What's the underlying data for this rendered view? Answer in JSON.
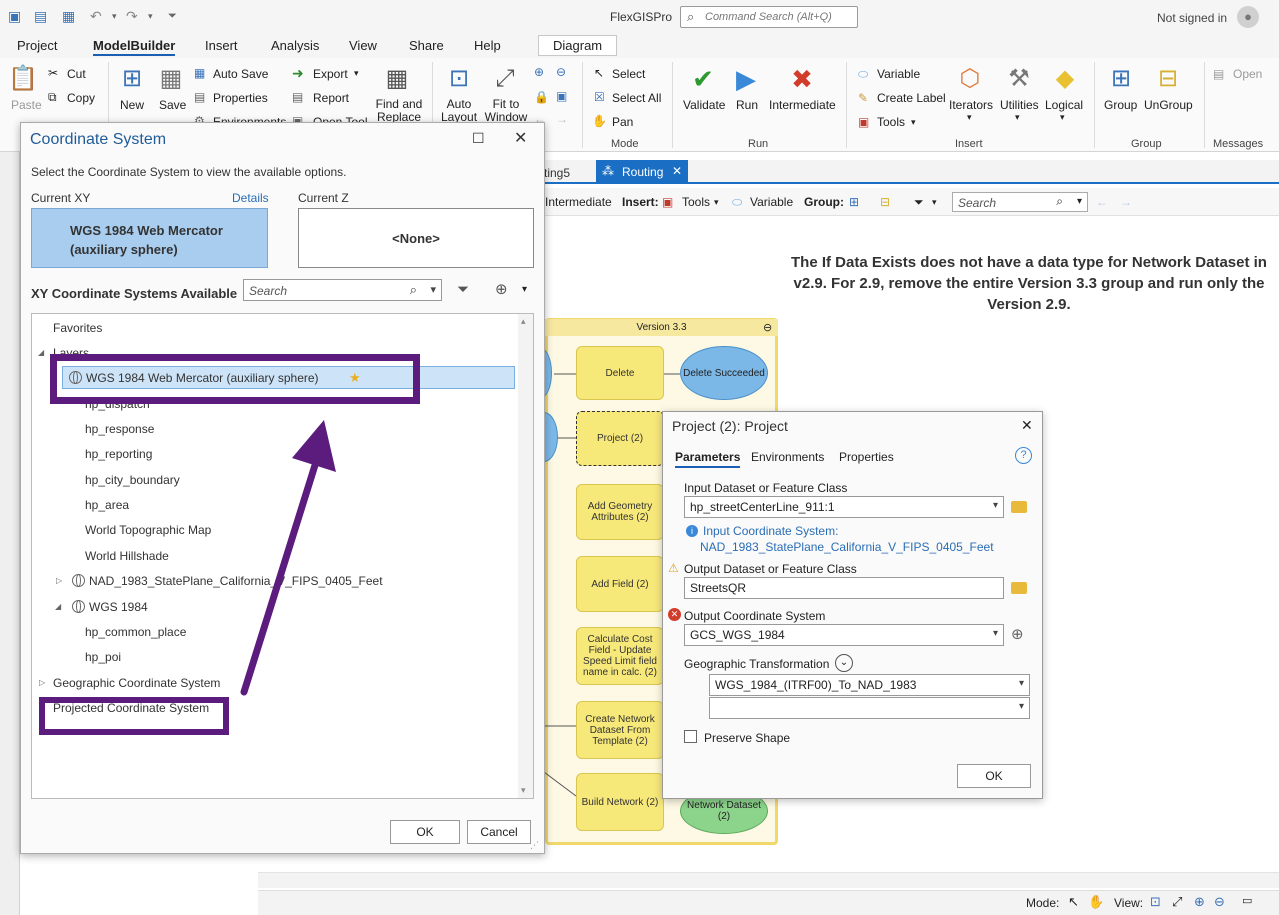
{
  "app": {
    "title": "FlexGISPro",
    "command_search_placeholder": "Command Search (Alt+Q)",
    "signin": "Not signed in"
  },
  "ribbon_tabs": [
    "Project",
    "ModelBuilder",
    "Insert",
    "Analysis",
    "View",
    "Share",
    "Help",
    "Diagram"
  ],
  "ribbon": {
    "paste": "Paste",
    "cut": "Cut",
    "copy": "Copy",
    "new": "New",
    "save": "Save",
    "auto_save": "Auto Save",
    "properties": "Properties",
    "environments": "Environments",
    "export": "Export",
    "report": "Report",
    "open_tool": "Open Tool",
    "find_replace": "Find and Replace",
    "auto_layout": "Auto Layout",
    "fit_to_window": "Fit to Window",
    "select": "Select",
    "select_all": "Select All",
    "pan": "Pan",
    "mode_group": "Mode",
    "validate": "Validate",
    "run": "Run",
    "intermediate": "Intermediate",
    "run_group": "Run",
    "variable": "Variable",
    "create_label": "Create Label",
    "tools": "Tools",
    "iterators": "Iterators",
    "utilities": "Utilities",
    "logical": "Logical",
    "insert_group": "Insert",
    "group": "Group",
    "ungroup": "UnGroup",
    "group_group": "Group",
    "open": "Open",
    "messages_group": "Messages"
  },
  "model_view": {
    "prev_tab": "ting5",
    "tab": "Routing",
    "toolbar": {
      "intermediate": "Intermediate",
      "insert": "Insert:",
      "tools": "Tools",
      "variable": "Variable",
      "group": "Group:",
      "search_placeholder": "Search"
    },
    "note": "The If Data Exists does not have a data type for Network Dataset in v2.9.  For 2.9, remove the entire Version 3.3 group and run only the Version 2.9.",
    "group_title": "Version 3.3",
    "nodes": {
      "delete": "Delete",
      "delete_succeeded": "Delete Succeeded",
      "project": "Project (2)",
      "add_geometry": "Add Geometry Attributes (2)",
      "add_field": "Add Field (2)",
      "calc_cost": "Calculate Cost Field - Update Speed Limit field name in calc. (2)",
      "create_network": "Create Network Dataset From Template (2)",
      "build_network": "Build Network (2)",
      "network_dataset": "Network Dataset (2)"
    },
    "status": {
      "mode": "Mode:",
      "view": "View:"
    }
  },
  "coord_dialog": {
    "title": "Coordinate System",
    "instructions": "Select the Coordinate System to view the available options.",
    "current_xy_label": "Current XY",
    "details": "Details",
    "current_xy_value_line1": "WGS 1984 Web Mercator",
    "current_xy_value_line2": "(auxiliary sphere)",
    "current_z_label": "Current Z",
    "current_z_value": "<None>",
    "available_label": "XY Coordinate Systems Available",
    "search_placeholder": "Search",
    "tree": {
      "favorites": "Favorites",
      "layers": "Layers",
      "selected": "WGS 1984 Web Mercator (auxiliary sphere)",
      "layer_items": [
        "hp_dispatch",
        "hp_response",
        "hp_reporting",
        "hp_city_boundary",
        "hp_area",
        "World Topographic Map",
        "World Hillshade"
      ],
      "nad": "NAD_1983_StatePlane_California_V_FIPS_0405_Feet",
      "wgs": "WGS 1984",
      "wgs_items": [
        "hp_common_place",
        "hp_poi"
      ],
      "geographic": "Geographic Coordinate System",
      "projected": "Projected Coordinate System"
    },
    "ok": "OK",
    "cancel": "Cancel"
  },
  "project_dialog": {
    "title": "Project (2): Project",
    "tabs": [
      "Parameters",
      "Environments",
      "Properties"
    ],
    "input_label": "Input Dataset or Feature Class",
    "input_value": "hp_streetCenterLine_911:1",
    "input_cs_label": "Input Coordinate System:",
    "input_cs_value": "NAD_1983_StatePlane_California_V_FIPS_0405_Feet",
    "output_label": "Output Dataset or Feature Class",
    "output_value": "StreetsQR",
    "output_cs_label": "Output Coordinate System",
    "output_cs_value": "GCS_WGS_1984",
    "geo_transform_label": "Geographic Transformation",
    "geo_transform_value": "WGS_1984_(ITRF00)_To_NAD_1983",
    "geo_transform_value2": "",
    "preserve_shape": "Preserve Shape",
    "ok": "OK"
  },
  "colors": {
    "accent": "#1a6fc4",
    "highlight": "#5b1c7e",
    "node_yellow": "#f7e87a",
    "node_blue": "#7bb8e8",
    "node_green": "#8cd48c"
  }
}
